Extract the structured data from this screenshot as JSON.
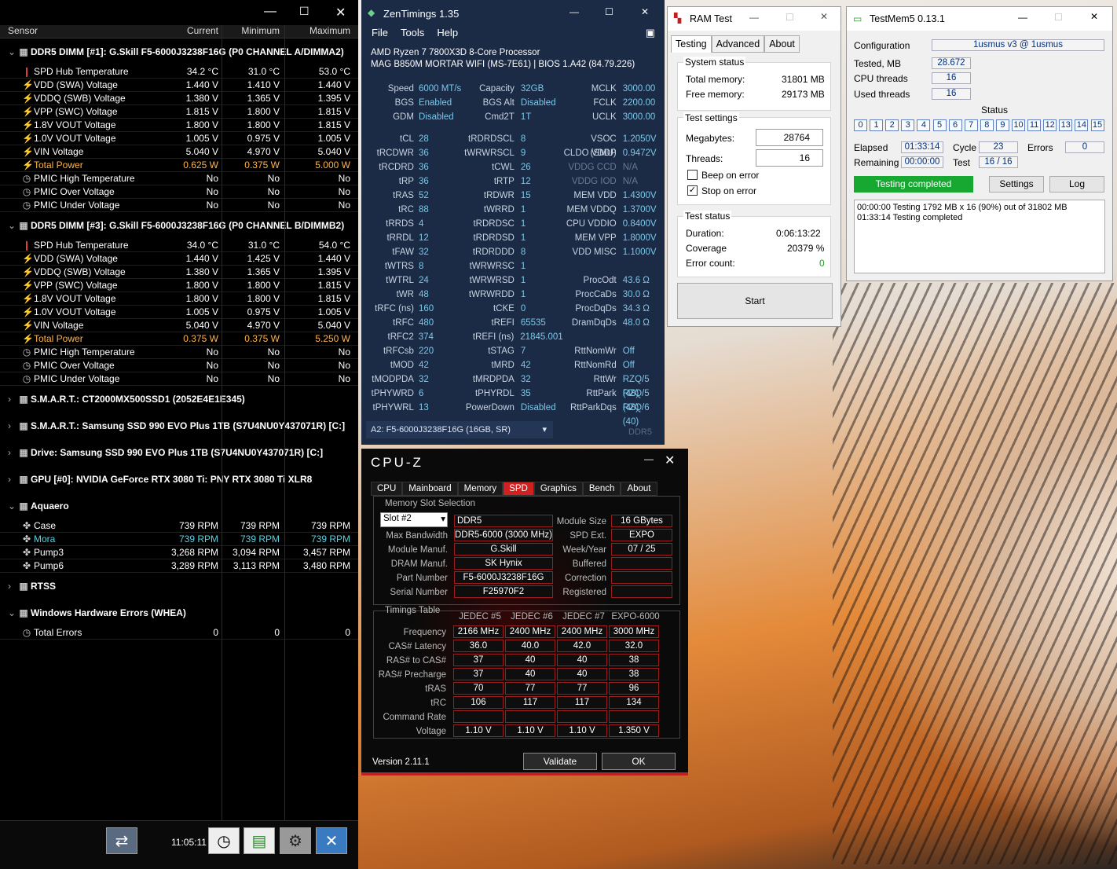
{
  "hwinfo": {
    "headers": [
      "Sensor",
      "Current",
      "Minimum",
      "Maximum"
    ],
    "groups": [
      {
        "title": "DDR5 DIMM [#1]: G.Skill F5-6000J3238F16G (P0 CHANNEL A/DIMMA2)",
        "expanded": true,
        "rows": [
          [
            "SPD Hub Temperature",
            "34.2 °C",
            "31.0 °C",
            "53.0 °C",
            "therm"
          ],
          [
            "VDD (SWA) Voltage",
            "1.440 V",
            "1.410 V",
            "1.440 V",
            "bolt"
          ],
          [
            "VDDQ (SWB) Voltage",
            "1.380 V",
            "1.365 V",
            "1.395 V",
            "bolt"
          ],
          [
            "VPP (SWC) Voltage",
            "1.815 V",
            "1.800 V",
            "1.815 V",
            "bolt"
          ],
          [
            "1.8V VOUT Voltage",
            "1.800 V",
            "1.800 V",
            "1.815 V",
            "bolt"
          ],
          [
            "1.0V VOUT Voltage",
            "1.005 V",
            "0.975 V",
            "1.005 V",
            "bolt"
          ],
          [
            "VIN Voltage",
            "5.040 V",
            "4.970 V",
            "5.040 V",
            "bolt"
          ],
          [
            "Total Power",
            "0.625 W",
            "0.375 W",
            "5.000 W",
            "bolt-o"
          ],
          [
            "PMIC High Temperature",
            "No",
            "No",
            "No",
            "clock"
          ],
          [
            "PMIC Over Voltage",
            "No",
            "No",
            "No",
            "clock"
          ],
          [
            "PMIC Under Voltage",
            "No",
            "No",
            "No",
            "clock"
          ]
        ]
      },
      {
        "title": "DDR5 DIMM [#3]: G.Skill F5-6000J3238F16G (P0 CHANNEL B/DIMMB2)",
        "expanded": true,
        "rows": [
          [
            "SPD Hub Temperature",
            "34.0 °C",
            "31.0 °C",
            "54.0 °C",
            "therm"
          ],
          [
            "VDD (SWA) Voltage",
            "1.440 V",
            "1.425 V",
            "1.440 V",
            "bolt"
          ],
          [
            "VDDQ (SWB) Voltage",
            "1.380 V",
            "1.365 V",
            "1.395 V",
            "bolt"
          ],
          [
            "VPP (SWC) Voltage",
            "1.800 V",
            "1.800 V",
            "1.815 V",
            "bolt"
          ],
          [
            "1.8V VOUT Voltage",
            "1.800 V",
            "1.800 V",
            "1.815 V",
            "bolt"
          ],
          [
            "1.0V VOUT Voltage",
            "1.005 V",
            "0.975 V",
            "1.005 V",
            "bolt"
          ],
          [
            "VIN Voltage",
            "5.040 V",
            "4.970 V",
            "5.040 V",
            "bolt"
          ],
          [
            "Total Power",
            "0.375 W",
            "0.375 W",
            "5.250 W",
            "bolt-o"
          ],
          [
            "PMIC High Temperature",
            "No",
            "No",
            "No",
            "clock"
          ],
          [
            "PMIC Over Voltage",
            "No",
            "No",
            "No",
            "clock"
          ],
          [
            "PMIC Under Voltage",
            "No",
            "No",
            "No",
            "clock"
          ]
        ]
      },
      {
        "title": "S.M.A.R.T.: CT2000MX500SSD1 (2052E4E1E345)",
        "expanded": false,
        "rows": []
      },
      {
        "title": "S.M.A.R.T.: Samsung SSD 990 EVO Plus 1TB (S7U4NU0Y437071R) [C:]",
        "expanded": false,
        "rows": []
      },
      {
        "title": "Drive: Samsung SSD 990 EVO Plus 1TB (S7U4NU0Y437071R) [C:]",
        "expanded": false,
        "rows": []
      },
      {
        "title": "GPU [#0]: NVIDIA GeForce RTX 3080 Ti: PNY RTX 3080 Ti XLR8",
        "expanded": false,
        "rows": []
      },
      {
        "title": "Aquaero",
        "expanded": true,
        "rows": [
          [
            "Case",
            "739 RPM",
            "739 RPM",
            "739 RPM",
            "fan"
          ],
          [
            "Mora",
            "739 RPM",
            "739 RPM",
            "739 RPM",
            "fan-c"
          ],
          [
            "Pump3",
            "3,268 RPM",
            "3,094 RPM",
            "3,457 RPM",
            "fan"
          ],
          [
            "Pump6",
            "3,289 RPM",
            "3,113 RPM",
            "3,480 RPM",
            "fan"
          ]
        ]
      },
      {
        "title": "RTSS",
        "expanded": false,
        "rows": []
      },
      {
        "title": "Windows Hardware Errors (WHEA)",
        "expanded": true,
        "rows": [
          [
            "Total Errors",
            "0",
            "0",
            "0",
            "clock"
          ]
        ]
      }
    ],
    "clock": "11:05:11"
  },
  "zen": {
    "title": "ZenTimings 1.35",
    "menu": [
      "File",
      "Tools",
      "Help"
    ],
    "cpu": "AMD Ryzen 7 7800X3D 8-Core Processor",
    "board": "MAG B850M MORTAR WIFI (MS-7E61) | BIOS 1.A42 (84.79.226)",
    "top": [
      [
        "Speed",
        "6000 MT/s",
        "Capacity",
        "32GB",
        "MCLK",
        "3000.00"
      ],
      [
        "BGS",
        "Enabled",
        "BGS Alt",
        "Disabled",
        "FCLK",
        "2200.00"
      ],
      [
        "GDM",
        "Disabled",
        "Cmd2T",
        "1T",
        "UCLK",
        "3000.00"
      ]
    ],
    "rows": [
      [
        "tCL",
        "28",
        "tRDRDSCL",
        "8",
        "VSOC (SMU)",
        "1.2050V"
      ],
      [
        "tRCDWR",
        "36",
        "tWRWRSCL",
        "9",
        "CLDO VDDP",
        "0.9472V"
      ],
      [
        "tRCDRD",
        "36",
        "tCWL",
        "26",
        "VDDG CCD",
        "N/A"
      ],
      [
        "tRP",
        "36",
        "tRTP",
        "12",
        "VDDG IOD",
        "N/A"
      ],
      [
        "tRAS",
        "52",
        "tRDWR",
        "15",
        "MEM VDD",
        "1.4300V"
      ],
      [
        "tRC",
        "88",
        "tWRRD",
        "1",
        "MEM VDDQ",
        "1.3700V"
      ],
      [
        "tRRDS",
        "4",
        "tRDRDSC",
        "1",
        "CPU VDDIO",
        "0.8400V"
      ],
      [
        "tRRDL",
        "12",
        "tRDRDSD",
        "1",
        "MEM VPP",
        "1.8000V"
      ],
      [
        "tFAW",
        "32",
        "tRDRDDD",
        "8",
        "VDD MISC",
        "1.1000V"
      ],
      [
        "tWTRS",
        "8",
        "tWRWRSC",
        "1",
        "",
        ""
      ],
      [
        "tWTRL",
        "24",
        "tWRWRSD",
        "1",
        "ProcOdt",
        "43.6 Ω"
      ],
      [
        "tWR",
        "48",
        "tWRWRDD",
        "1",
        "ProcCaDs",
        "30.0 Ω"
      ],
      [
        "tRFC (ns)",
        "160",
        "tCKE",
        "0",
        "ProcDqDs",
        "34.3 Ω"
      ],
      [
        "tRFC",
        "480",
        "tREFI",
        "65535",
        "DramDqDs",
        "48.0 Ω"
      ],
      [
        "tRFC2",
        "374",
        "tREFI (ns)",
        "21845.001",
        "",
        ""
      ],
      [
        "tRFCsb",
        "220",
        "tSTAG",
        "7",
        "RttNomWr",
        "Off"
      ],
      [
        "tMOD",
        "42",
        "tMRD",
        "42",
        "RttNomRd",
        "Off"
      ],
      [
        "tMODPDA",
        "32",
        "tMRDPDA",
        "32",
        "RttWr",
        "RZQ/5 (48)"
      ],
      [
        "tPHYWRD",
        "6",
        "tPHYRDL",
        "35",
        "RttPark",
        "RZQ/5 (48)"
      ],
      [
        "tPHYWRL",
        "13",
        "PowerDown",
        "Disabled",
        "RttParkDqs",
        "RZQ/6 (40)"
      ]
    ],
    "slot": "A2: F5-6000J3238F16G (16GB, SR)",
    "type": "DDR5"
  },
  "ramtest": {
    "title": "RAM Test",
    "tabs": [
      "Testing",
      "Advanced",
      "About"
    ],
    "system_status": "System status",
    "total_label": "Total memory:",
    "total": "31801 MB",
    "free_label": "Free memory:",
    "free": "29173 MB",
    "settings": "Test settings",
    "mb_label": "Megabytes:",
    "mb": "28764",
    "threads_label": "Threads:",
    "threads": "16",
    "beep": "Beep on error",
    "stop": "Stop on error",
    "test_status": "Test status",
    "dur_label": "Duration:",
    "dur": "0:06:13:22",
    "cov_label": "Coverage",
    "cov": "20379 %",
    "err_label": "Error count:",
    "err": "0",
    "start": "Start"
  },
  "testmem5": {
    "title": "TestMem5 0.13.1",
    "config_label": "Configuration",
    "config": "1usmus v3 @ 1usmus",
    "tested_label": "Tested, MB",
    "tested": "28.672",
    "cpu_label": "CPU threads",
    "cpu": "16",
    "used_label": "Used threads",
    "used": "16",
    "status": "Status",
    "cells": [
      "0",
      "1",
      "2",
      "3",
      "4",
      "5",
      "6",
      "7",
      "8",
      "9",
      "10",
      "11",
      "12",
      "13",
      "14",
      "15"
    ],
    "elapsed_label": "Elapsed",
    "elapsed": "01:33:14",
    "cycle_label": "Cycle",
    "cycle": "23",
    "errors_label": "Errors",
    "errors": "0",
    "remaining_label": "Remaining",
    "remaining": "00:00:00",
    "test_label": "Test",
    "test": "16 / 16",
    "completed": "Testing completed",
    "settings": "Settings",
    "log": "Log",
    "log1": "00:00:00  Testing 1792 MB x 16 (90%) out of 31802 MB",
    "log2": "01:33:14  Testing completed"
  },
  "cpuz": {
    "title": "CPU-Z",
    "tabs": [
      "CPU",
      "Mainboard",
      "Memory",
      "SPD",
      "Graphics",
      "Bench",
      "About"
    ],
    "slot_sel": "Memory Slot Selection",
    "slot": "Slot #2",
    "type": "DDR5",
    "module_size_l": "Module Size",
    "module_size": "16 GBytes",
    "max_bw_l": "Max Bandwidth",
    "max_bw": "DDR5-6000 (3000 MHz)",
    "spd_ext_l": "SPD Ext.",
    "spd_ext": "EXPO",
    "manuf_l": "Module Manuf.",
    "manuf": "G.Skill",
    "week_l": "Week/Year",
    "week": "07 / 25",
    "dram_l": "DRAM Manuf.",
    "dram": "SK Hynix",
    "buffered": "Buffered",
    "part_l": "Part Number",
    "part": "F5-6000J3238F16G",
    "correction": "Correction",
    "serial_l": "Serial Number",
    "serial": "F25970F2",
    "registered": "Registered",
    "timings": "Timings Table",
    "cols": [
      "JEDEC #5",
      "JEDEC #6",
      "JEDEC #7",
      "EXPO-6000"
    ],
    "trows": [
      [
        "Frequency",
        "2166 MHz",
        "2400 MHz",
        "2400 MHz",
        "3000 MHz"
      ],
      [
        "CAS# Latency",
        "36.0",
        "40.0",
        "42.0",
        "32.0"
      ],
      [
        "RAS# to CAS#",
        "37",
        "40",
        "40",
        "38"
      ],
      [
        "RAS# Precharge",
        "37",
        "40",
        "40",
        "38"
      ],
      [
        "tRAS",
        "70",
        "77",
        "77",
        "96"
      ],
      [
        "tRC",
        "106",
        "117",
        "117",
        "134"
      ],
      [
        "Command Rate",
        "",
        "",
        "",
        ""
      ],
      [
        "Voltage",
        "1.10 V",
        "1.10 V",
        "1.10 V",
        "1.350 V"
      ]
    ],
    "version": "Version 2.11.1",
    "validate": "Validate",
    "ok": "OK"
  }
}
